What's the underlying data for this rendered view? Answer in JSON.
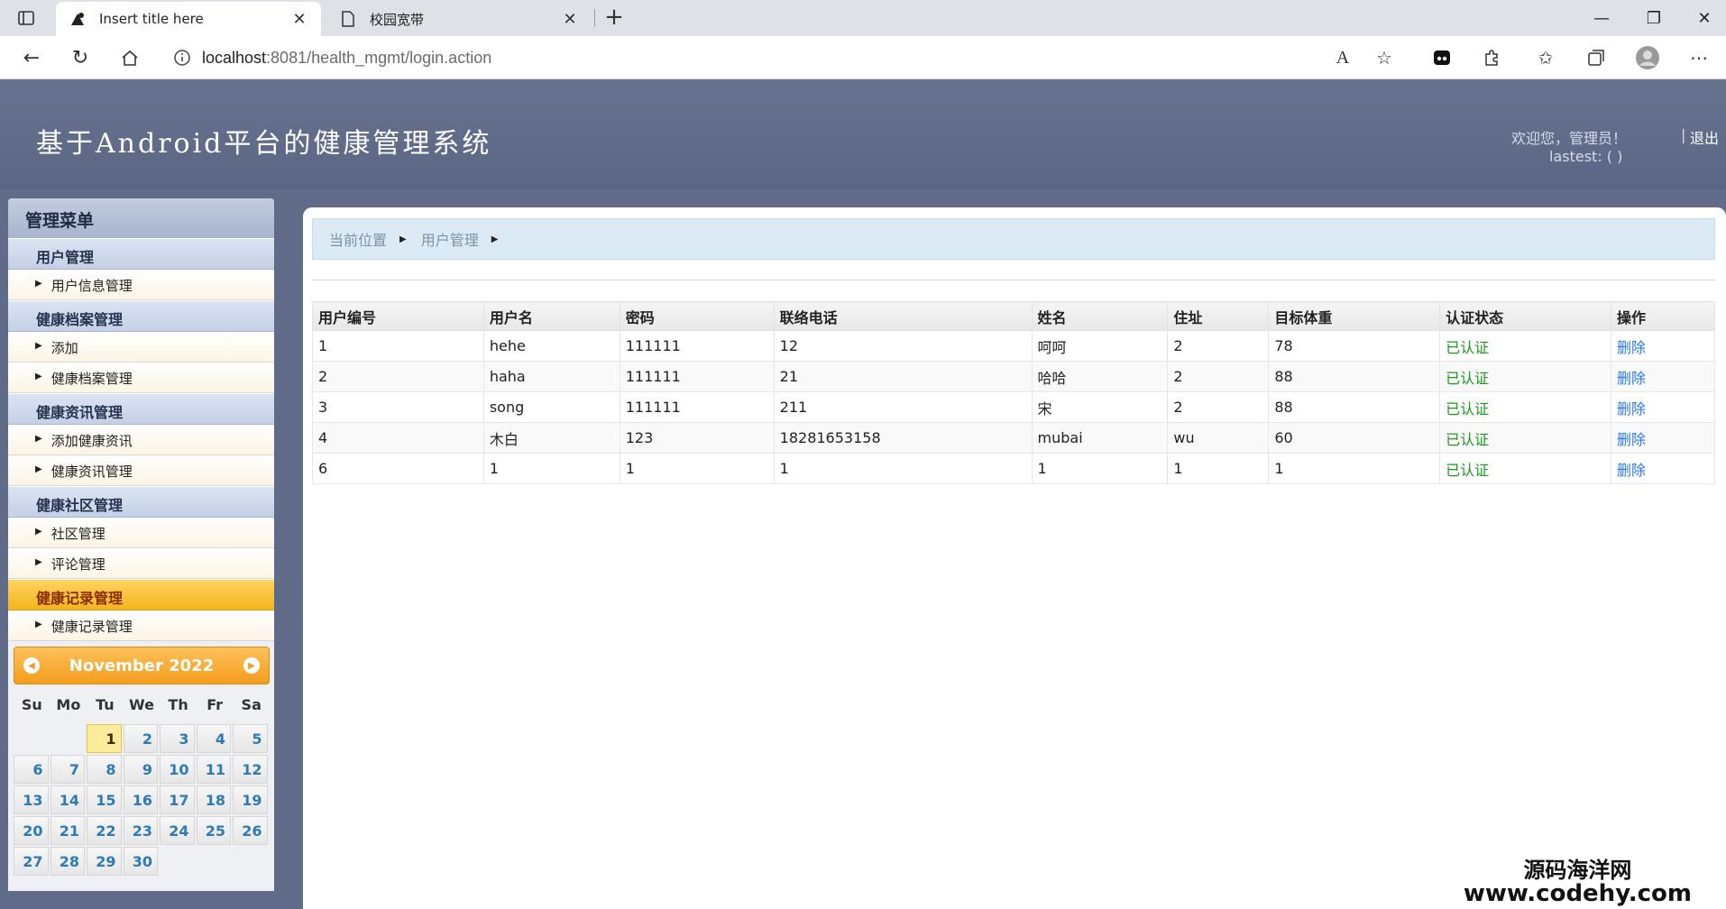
{
  "browser": {
    "tabs": [
      {
        "title": "Insert title here",
        "active": true
      },
      {
        "title": "校园宽带",
        "active": false
      }
    ],
    "url_host": "localhost",
    "url_rest": ":8081/health_mgmt/login.action"
  },
  "header": {
    "title": "基于Android平台的健康管理系统",
    "welcome": "欢迎您，管理员！",
    "logout_sep": "|",
    "logout": "退出",
    "lastest": "lastest: ( )"
  },
  "sidebar": {
    "title": "管理菜单",
    "groups": [
      {
        "label": "用户管理",
        "items": [
          "用户信息管理"
        ]
      },
      {
        "label": "健康档案管理",
        "items": [
          "添加",
          "健康档案管理"
        ]
      },
      {
        "label": "健康资讯管理",
        "items": [
          "添加健康资讯",
          "健康资讯管理"
        ]
      },
      {
        "label": "健康社区管理",
        "items": [
          "社区管理",
          "评论管理"
        ]
      },
      {
        "label": "健康记录管理",
        "items": [
          "健康记录管理"
        ],
        "active": true
      }
    ]
  },
  "calendar": {
    "month_label": "November 2022",
    "dow": [
      "Su",
      "Mo",
      "Tu",
      "We",
      "Th",
      "Fr",
      "Sa"
    ],
    "days": [
      "",
      "",
      "1",
      "2",
      "3",
      "4",
      "5",
      "6",
      "7",
      "8",
      "9",
      "10",
      "11",
      "12",
      "13",
      "14",
      "15",
      "16",
      "17",
      "18",
      "19",
      "20",
      "21",
      "22",
      "23",
      "24",
      "25",
      "26",
      "27",
      "28",
      "29",
      "30"
    ],
    "today": "1"
  },
  "breadcrumb": {
    "current_label": "当前位置",
    "page": "用户管理"
  },
  "table": {
    "columns": [
      "用户编号",
      "用户名",
      "密码",
      "联络电话",
      "姓名",
      "住址",
      "目标体重",
      "认证状态",
      "操作"
    ],
    "rows": [
      [
        "1",
        "hehe",
        "111111",
        "12",
        "呵呵",
        "2",
        "78",
        "已认证",
        "删除"
      ],
      [
        "2",
        "haha",
        "111111",
        "21",
        "哈哈",
        "2",
        "88",
        "已认证",
        "删除"
      ],
      [
        "3",
        "song",
        "111111",
        "211",
        "宋",
        "2",
        "88",
        "已认证",
        "删除"
      ],
      [
        "4",
        "木白",
        "123",
        "18281653158",
        "mubai",
        "wu",
        "60",
        "已认证",
        "删除"
      ],
      [
        "6",
        "1",
        "1",
        "1",
        "1",
        "1",
        "1",
        "已认证",
        "删除"
      ]
    ]
  },
  "watermark": {
    "line1": "源码海洋网",
    "line2": "www.codehy.com"
  },
  "colors": {
    "header_bg": "#5f6b89",
    "active_menu": "#f3b51e",
    "status_ok": "#1b9b1b",
    "link": "#2a7ae2"
  }
}
